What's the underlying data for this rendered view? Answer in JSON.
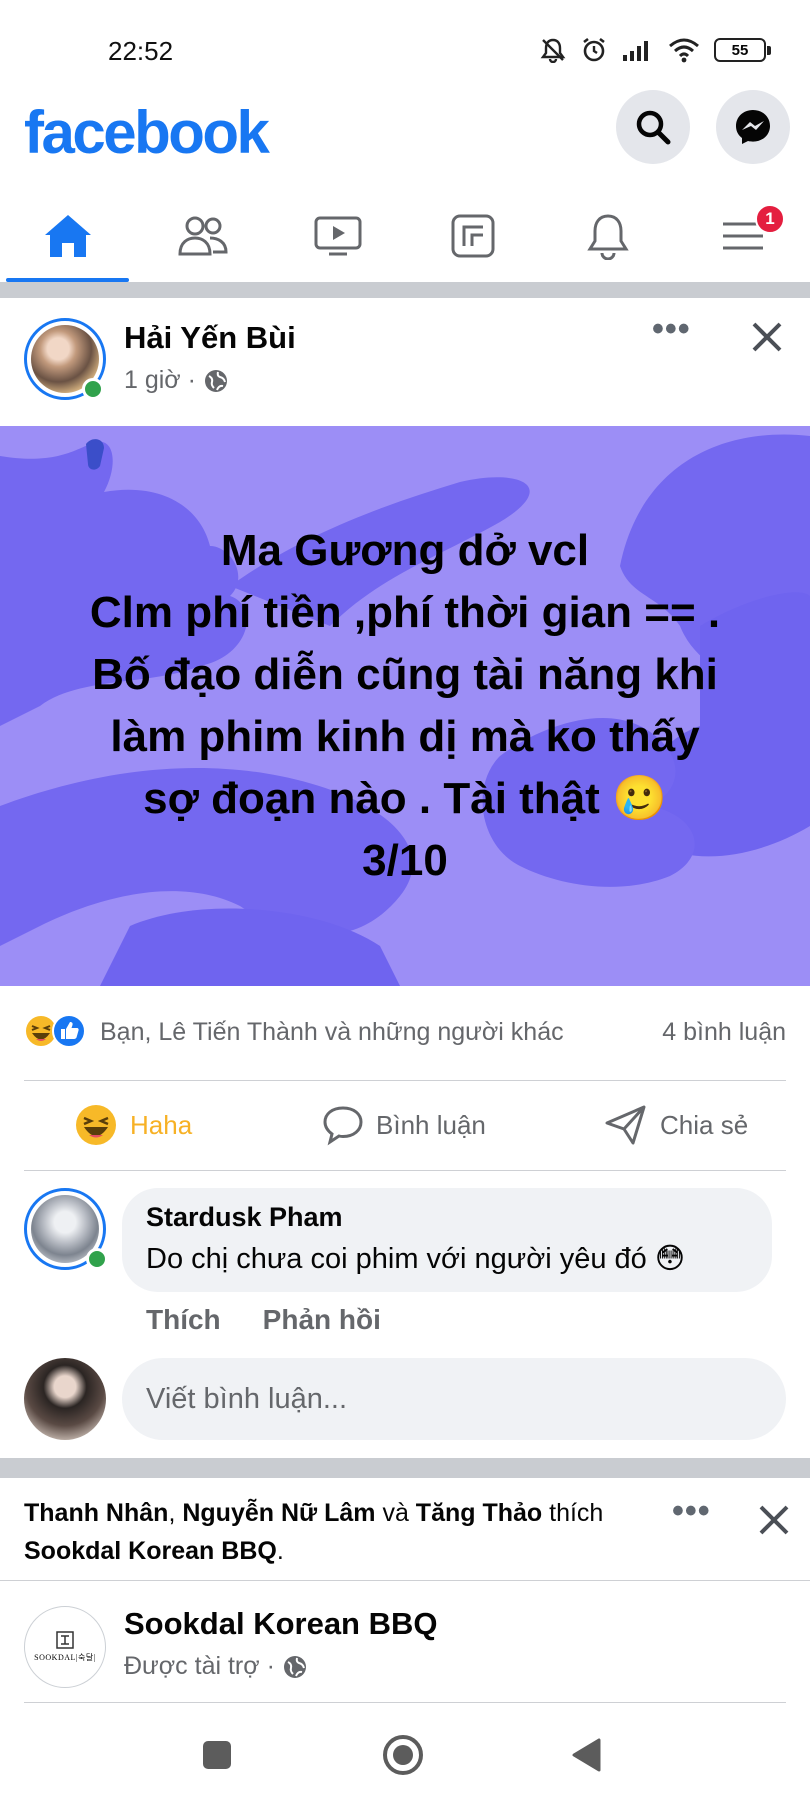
{
  "status_bar": {
    "time": "22:52",
    "battery": "55"
  },
  "header": {
    "logo": "facebook",
    "search_icon": "search-icon",
    "messenger_icon": "messenger-icon"
  },
  "tabs": [
    {
      "name": "home",
      "icon": "home-icon",
      "active": true
    },
    {
      "name": "friends",
      "icon": "friends-icon"
    },
    {
      "name": "watch",
      "icon": "video-icon"
    },
    {
      "name": "gaming",
      "icon": "gaming-icon"
    },
    {
      "name": "notifications",
      "icon": "bell-icon"
    },
    {
      "name": "menu",
      "icon": "menu-icon",
      "badge": "1"
    }
  ],
  "post": {
    "author": "Hải Yến Bùi",
    "time": "1 giờ ·",
    "body_lines": [
      "Ma Gương dở vcl",
      "Clm phí tiền ,phí thời gian == .",
      "Bố đạo diễn cũng tài năng khi",
      "làm phim kinh dị mà ko thấy",
      "sợ đoạn nào . Tài thật 🥲",
      "3/10"
    ],
    "background_color": "#9c8ef6",
    "reactions_summary": "Bạn, Lê Tiến Thành và những người khác",
    "comment_count": "4 bình luận",
    "actions": {
      "react": "Haha",
      "comment": "Bình luận",
      "share": "Chia sẻ"
    }
  },
  "comment": {
    "author": "Stardusk Pham",
    "text": "Do chị chưa coi phim với người yêu đó 😳",
    "like": "Thích",
    "reply": "Phản hồi"
  },
  "composer": {
    "placeholder": "Viết bình luận..."
  },
  "sponsored": {
    "liker1": "Thanh Nhân",
    "liker2": "Nguyễn Nữ Lâm",
    "conj": "và",
    "liker3": "Tăng Thảo",
    "verb": "thích",
    "page": "Sookdal Korean BBQ",
    "name": "Sookdal Korean BBQ",
    "meta": "Được tài trợ ·",
    "logo_text": "SOOKDAL|숙달|"
  },
  "colors": {
    "brand": "#1877f2",
    "online": "#31a24c",
    "badge": "#e41e3f"
  }
}
